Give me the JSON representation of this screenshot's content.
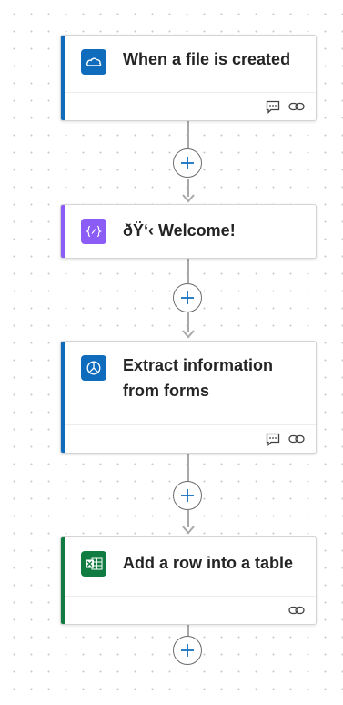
{
  "accents": {
    "trigger_blue": "#0f6cbd",
    "compose_purple": "#8b5cf6",
    "excel_green": "#107c41"
  },
  "steps": [
    {
      "title": "When a file is created",
      "icon": "onedrive-cloud-icon",
      "icon_bg": "#0f6cbd",
      "accent": "#0f6cbd",
      "footer_icons": [
        "comment-icon",
        "link-icon"
      ]
    },
    {
      "title": "ðŸ‘‹ Welcome!",
      "icon": "compose-braces-icon",
      "icon_bg": "#8b5cf6",
      "accent": "#8b5cf6",
      "footer_icons": []
    },
    {
      "title": "Extract information from forms",
      "icon": "ai-builder-icon",
      "icon_bg": "#0f6cbd",
      "accent": "#0f6cbd",
      "footer_icons": [
        "comment-icon",
        "link-icon"
      ]
    },
    {
      "title": "Add a row into a table",
      "icon": "excel-icon",
      "icon_bg": "#107c41",
      "accent": "#107c41",
      "footer_icons": [
        "link-icon"
      ]
    }
  ],
  "add_buttons": [
    "add-step-icon",
    "add-step-icon",
    "add-step-icon",
    "add-step-icon"
  ]
}
